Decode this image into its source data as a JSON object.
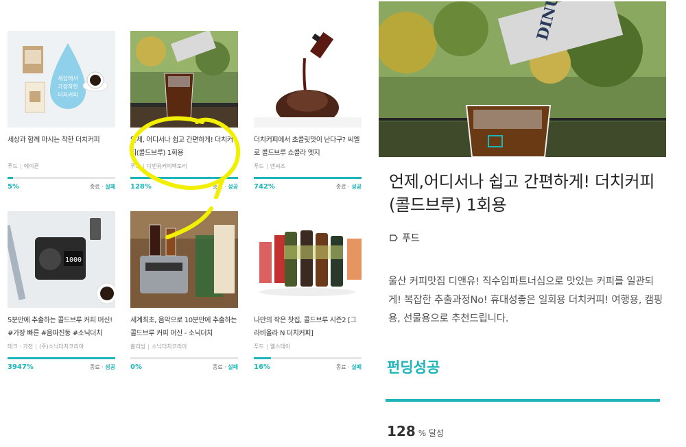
{
  "cards": [
    {
      "title": "세상과 함께 마시는 착한 더치커피",
      "category": "푸드",
      "maker": "에이른",
      "percent": "5%",
      "fill": 0.05,
      "status_prefix": "종료 · ",
      "status": "실패",
      "icon": "coffee-pack-image"
    },
    {
      "title": "언제, 어디서나 쉽고 간편하게! 더치커피(콜드브루) 1회용",
      "category": "푸드",
      "maker": "디앤유커피팩토리",
      "percent": "128%",
      "fill": 1.0,
      "status_prefix": "종료 · ",
      "status": "성공",
      "icon": "iced-coffee-image"
    },
    {
      "title": "더치커피에서 초콜릿맛이 난다구? 씨엘로 콜드브루 쇼콜라 엣지",
      "category": "푸드",
      "maker": "엔씨즈",
      "percent": "742%",
      "fill": 1.0,
      "status_prefix": "종료 · ",
      "status": "성공",
      "icon": "chocolate-pour-image"
    },
    {
      "title": "5분만에 추출하는 콜드브루 커피 머신! #가장 빠른 #음파진동 #소닉더치",
      "category": "테크 · 가전",
      "maker": "(주)소닉더치코리아",
      "percent": "3947%",
      "fill": 1.0,
      "status_prefix": "종료 · ",
      "status": "성공",
      "icon": "speaker-machine-image"
    },
    {
      "title": "세계최초, 음악으로 10분만에 추출하는 콜드브루 커피 머신 - 소닉더치",
      "category": "홈리빙",
      "maker": "소닉더치코리아",
      "percent": "0%",
      "fill": 0.0,
      "status_prefix": "종료 · ",
      "status": "실패",
      "icon": "coffee-machine-image"
    },
    {
      "title": "나만의 작은 찻집, 콜드브루 시즌2 [그라비올라 N 더치커피]",
      "category": "푸드",
      "maker": "웰스테이",
      "percent": "16%",
      "fill": 0.16,
      "status_prefix": "종료 · ",
      "status": "실패",
      "icon": "bottles-image"
    }
  ],
  "detail": {
    "title": "언제,어디서나 쉽고 간편하게! 더치커피(콜드브루) 1회용",
    "category": "푸드",
    "description": "울산 커피맛집 디앤유! 직수입파트너십으로 맛있는 커피를 일관되게! 복잡한 추출과정No! 휴대성좋은 일회용 더치커피! 여행용, 캠핑용, 선물용으로 추천드립니다.",
    "status": "펀딩성공",
    "percent_value": "128",
    "percent_unit": "% 달성",
    "progress": 1.0
  },
  "hero_brand": "DINU",
  "colors": {
    "accent": "#1cb5b9",
    "highlight": "#f2f000"
  }
}
